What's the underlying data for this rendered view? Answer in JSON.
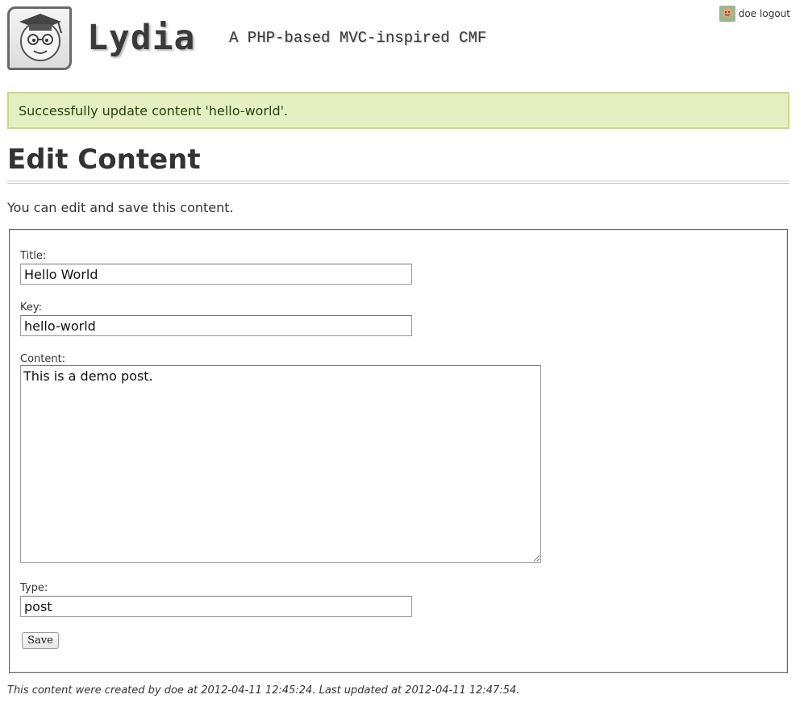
{
  "header": {
    "title": "Lydia",
    "slogan": "A PHP-based MVC-inspired CMF",
    "login": {
      "user": "doe",
      "logout": "logout"
    }
  },
  "flash": {
    "message": "Successfully update content 'hello-world'."
  },
  "page": {
    "title": "Edit Content",
    "intro": "You can edit and save this content."
  },
  "form": {
    "title_label": "Title:",
    "title_value": "Hello World",
    "key_label": "Key:",
    "key_value": "hello-world",
    "content_label": "Content:",
    "content_value": "This is a demo post.",
    "type_label": "Type:",
    "type_value": "post",
    "save_label": "Save"
  },
  "meta": {
    "footer": "This content were created by doe at 2012-04-11 12:45:24. Last updated at 2012-04-11 12:47:54."
  },
  "colors": {
    "flash_bg": "#e6efc2",
    "flash_border": "#c6d880",
    "flash_text": "#264409",
    "text": "#333333"
  },
  "icons": {
    "logo": "graduate-face-icon",
    "avatar": "user-avatar-icon",
    "resize": "resize-grip-icon"
  }
}
